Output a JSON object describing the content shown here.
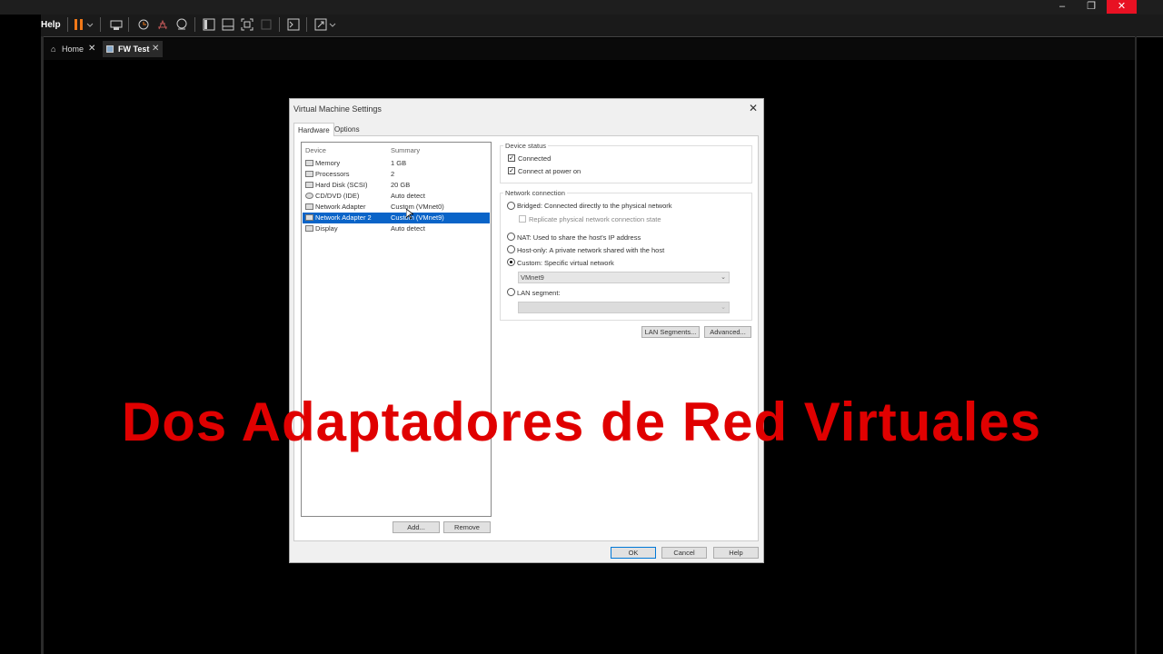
{
  "menu": {
    "help": "Help"
  },
  "window_controls": {
    "minimize": "–",
    "restore": "❐",
    "close": "✕"
  },
  "tabs": [
    {
      "label": "Home"
    },
    {
      "label": "FW Test"
    }
  ],
  "dialog": {
    "title": "Virtual Machine Settings",
    "tabs": [
      "Hardware",
      "Options"
    ],
    "columns": {
      "device": "Device",
      "summary": "Summary"
    },
    "devices": [
      {
        "device": "Memory",
        "summary": "1 GB"
      },
      {
        "device": "Processors",
        "summary": "2"
      },
      {
        "device": "Hard Disk (SCSI)",
        "summary": "20 GB"
      },
      {
        "device": "CD/DVD (IDE)",
        "summary": "Auto detect"
      },
      {
        "device": "Network Adapter",
        "summary": "Custom (VMnet0)"
      },
      {
        "device": "Network Adapter 2",
        "summary": "Custom (VMnet9)"
      },
      {
        "device": "Display",
        "summary": "Auto detect"
      }
    ],
    "selected_device": "Network Adapter 2",
    "add_label": "Add...",
    "remove_label": "Remove",
    "device_status": {
      "title": "Device status",
      "connected": "Connected",
      "connect_at_power_on": "Connect at power on"
    },
    "network_connection": {
      "title": "Network connection",
      "bridged": "Bridged: Connected directly to the physical network",
      "replicate": "Replicate physical network connection state",
      "nat": "NAT: Used to share the host's IP address",
      "host_only": "Host-only: A private network shared with the host",
      "custom": "Custom: Specific virtual network",
      "custom_value": "VMnet9",
      "lan_segment": "LAN segment:",
      "lan_value": ""
    },
    "lan_segments_label": "LAN Segments...",
    "advanced_label": "Advanced...",
    "ok_label": "OK",
    "cancel_label": "Cancel",
    "help_label": "Help"
  },
  "overlay_text": "Dos Adaptadores de Red Virtuales",
  "colors": {
    "accent": "#0a64c8",
    "overlay": "#e00000",
    "close_red": "#e81123",
    "pause_orange": "#f07818"
  }
}
